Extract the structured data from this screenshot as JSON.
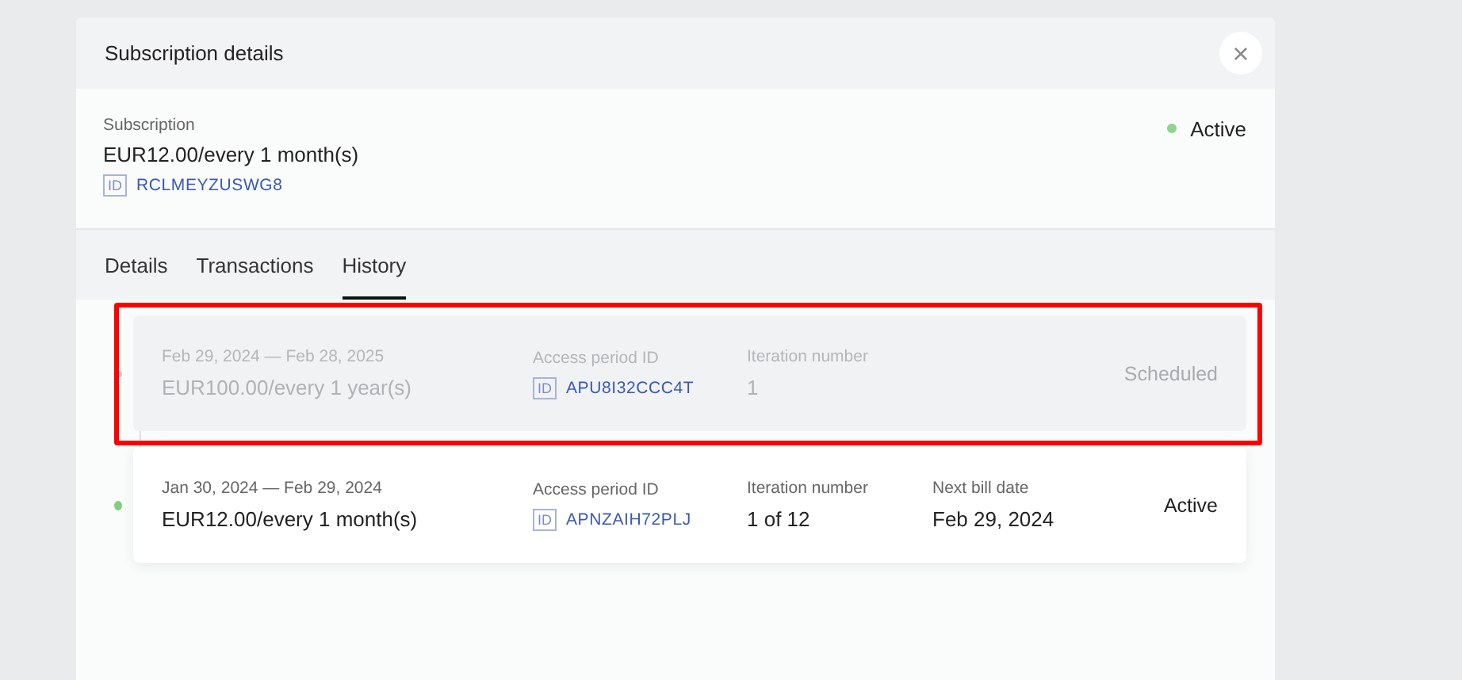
{
  "dialog": {
    "title": "Subscription details",
    "close_label": "×"
  },
  "subscription": {
    "label": "Subscription",
    "price": "EUR12.00/every 1 month(s)",
    "id_badge": "ID",
    "id": "RCLMEYZUSWG8",
    "status": "Active",
    "active": true
  },
  "tabs": [
    {
      "label": "Details",
      "selected": false
    },
    {
      "label": "Transactions",
      "selected": false
    },
    {
      "label": "History",
      "selected": true
    }
  ],
  "history": [
    {
      "period": "Feb 29, 2024 — Feb 28, 2025",
      "price": "EUR100.00/every 1 year(s)",
      "access_label": "Access period ID",
      "id_badge": "ID",
      "access_id": "APU8I32CCC4T",
      "iteration_label": "Iteration number",
      "iteration": "1",
      "status": "Scheduled",
      "scheduled": true,
      "highlighted": true,
      "color": "#c8cacd"
    },
    {
      "period": "Jan 30, 2024 — Feb 29, 2024",
      "price": "EUR12.00/every 1 month(s)",
      "access_label": "Access period ID",
      "id_badge": "ID",
      "access_id": "APNZAIH72PLJ",
      "iteration_label": "Iteration number",
      "iteration": "1 of 12",
      "next_bill_label": "Next bill date",
      "next_bill": "Feb 29, 2024",
      "status": "Active",
      "scheduled": false,
      "highlighted": false,
      "color": "#7fcf7f"
    }
  ]
}
